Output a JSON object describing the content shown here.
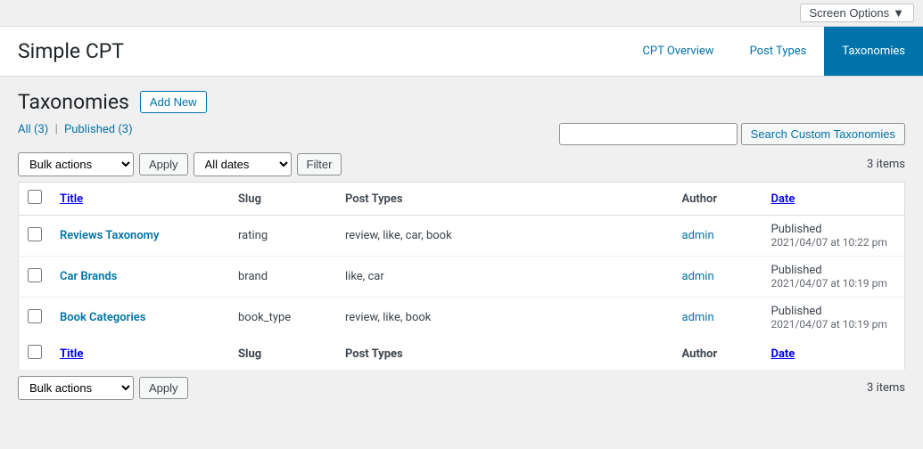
{
  "screenOptions": {
    "label": "Screen Options",
    "chevron": "▼"
  },
  "header": {
    "title": "Simple CPT",
    "nav": [
      {
        "id": "cpt-overview",
        "label": "CPT Overview",
        "active": false
      },
      {
        "id": "post-types",
        "label": "Post Types",
        "active": false
      },
      {
        "id": "taxonomies",
        "label": "Taxonomies",
        "active": true
      }
    ]
  },
  "page": {
    "title": "Taxonomies",
    "addNewLabel": "Add New"
  },
  "filterLinks": {
    "all": "All",
    "allCount": "(3)",
    "separator": "|",
    "published": "Published",
    "publishedCount": "(3)"
  },
  "search": {
    "placeholder": "",
    "buttonLabel": "Search Custom Taxonomies"
  },
  "actionsTop": {
    "bulkActionsLabel": "Bulk actions",
    "applyLabel": "Apply",
    "allDatesLabel": "All dates",
    "filterLabel": "Filter",
    "itemCount": "3 items"
  },
  "table": {
    "columns": [
      {
        "id": "cb",
        "label": ""
      },
      {
        "id": "title",
        "label": "Title"
      },
      {
        "id": "slug",
        "label": "Slug"
      },
      {
        "id": "post-types",
        "label": "Post Types"
      },
      {
        "id": "author",
        "label": "Author"
      },
      {
        "id": "date",
        "label": "Date"
      }
    ],
    "rows": [
      {
        "title": "Reviews Taxonomy",
        "slug": "rating",
        "postTypes": "review, like, car, book",
        "author": "admin",
        "dateStatus": "Published",
        "dateTime": "2021/04/07 at 10:22 pm"
      },
      {
        "title": "Car Brands",
        "slug": "brand",
        "postTypes": "like, car",
        "author": "admin",
        "dateStatus": "Published",
        "dateTime": "2021/04/07 at 10:19 pm"
      },
      {
        "title": "Book Categories",
        "slug": "book_type",
        "postTypes": "review, like, book",
        "author": "admin",
        "dateStatus": "Published",
        "dateTime": "2021/04/07 at 10:19 pm"
      }
    ],
    "footerColumns": [
      {
        "id": "cb",
        "label": ""
      },
      {
        "id": "title",
        "label": "Title"
      },
      {
        "id": "slug",
        "label": "Slug"
      },
      {
        "id": "post-types",
        "label": "Post Types"
      },
      {
        "id": "author",
        "label": "Author"
      },
      {
        "id": "date",
        "label": "Date"
      }
    ]
  },
  "actionsBottom": {
    "bulkActionsLabel": "Bulk actions",
    "applyLabel": "Apply",
    "itemCount": "3 items"
  }
}
